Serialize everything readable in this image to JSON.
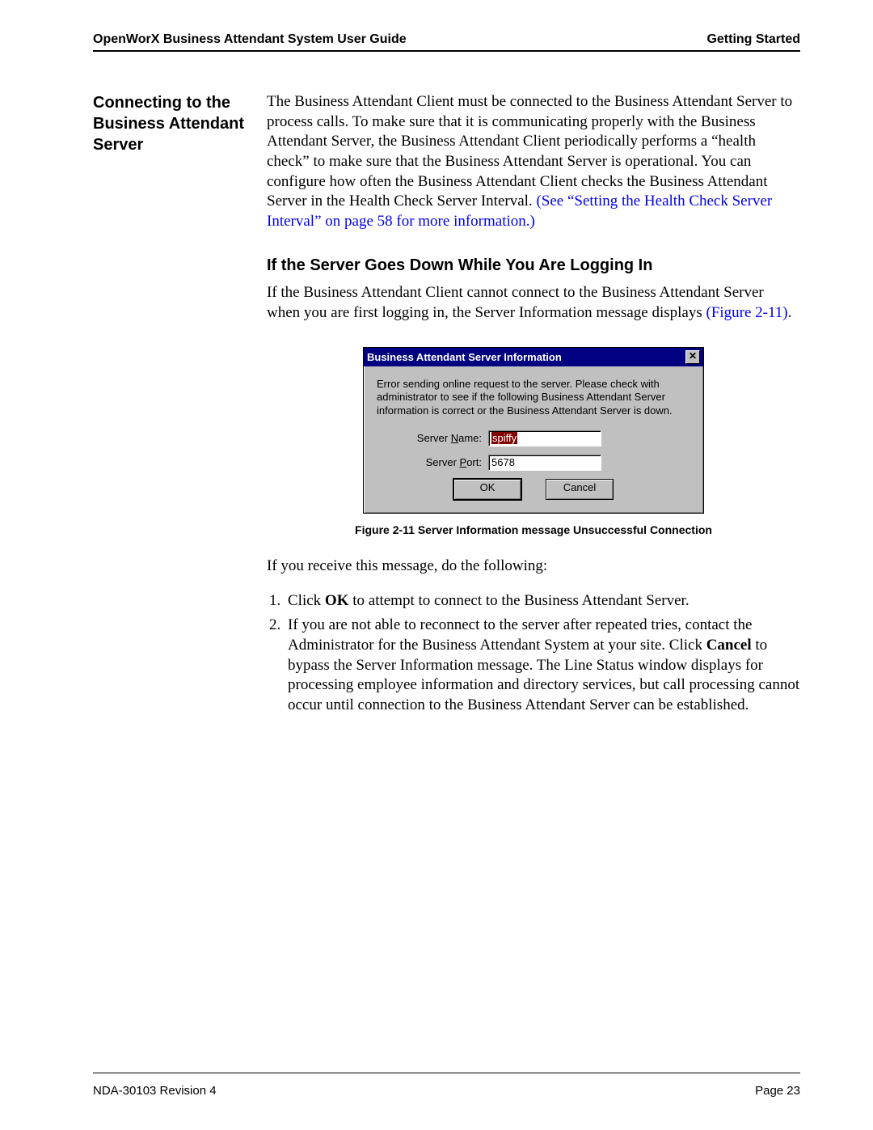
{
  "header": {
    "left": "OpenWorX Business Attendant System User Guide",
    "right": "Getting Started"
  },
  "section": {
    "title": "Connecting to the Business Attendant Server",
    "paragraph_main": "The Business Attendant Client must be connected to the Business Attendant Server to process calls. To make sure that it is communicating properly with the Business Attendant Server, the Business Attendant Client periodically performs a “health check” to make sure that the Business Attendant Server is operational. You can configure how often the Business Attendant Client checks the Business Attendant Server in the Health Check Server Interval. ",
    "paragraph_link": "(See “Setting the Health Check Server Interval” on page 58 for more information.)"
  },
  "subsection": {
    "heading": "If the Server Goes Down While You Are Logging In",
    "paragraph_pre": "If the Business Attendant Client cannot connect to the Business Attendant Server when you are first logging in, the Server Information message displays ",
    "paragraph_link": "(Figure 2-11)",
    "paragraph_post": "."
  },
  "dialog": {
    "title": "Business Attendant Server Information",
    "message": "Error sending online request to the server. Please check with administrator to see if the following Business Attendant Server information is correct or the Business Attendant Server is down.",
    "server_name_label_pre": "Server ",
    "server_name_label_u": "N",
    "server_name_label_post": "ame:",
    "server_name_value": "spiffy",
    "server_port_label_pre": "Server ",
    "server_port_label_u": "P",
    "server_port_label_post": "ort:",
    "server_port_value": "5678",
    "ok_label": "OK",
    "cancel_label": "Cancel",
    "close_label": "✕"
  },
  "figure_caption": "Figure 2-11   Server Information message Unsuccessful Connection",
  "followup": {
    "intro": "If you receive this message, do the following:",
    "step1_pre": "Click ",
    "step1_bold": "OK",
    "step1_post": " to attempt to connect to the Business Attendant Server.",
    "step2_pre": "If you are not able to reconnect to the server after repeated tries, contact the Administrator for the Business Attendant System at your site. Click ",
    "step2_bold": "Cancel",
    "step2_post": " to bypass the Server Information message. The Line Status window displays for processing employee information and directory services, but call processing cannot occur until connection to the Business Attendant Server can be established."
  },
  "footer": {
    "left": "NDA-30103  Revision 4",
    "right": "Page 23"
  }
}
